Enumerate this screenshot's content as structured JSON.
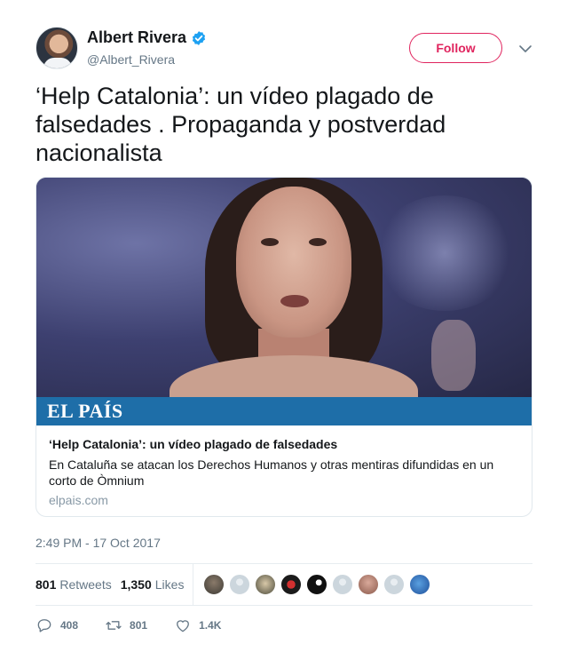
{
  "author": {
    "name": "Albert Rivera",
    "handle": "@Albert_Rivera",
    "verified": true
  },
  "follow_label": "Follow",
  "tweet_text": "‘Help Catalonia’: un vídeo plagado de falsedades . Propaganda y postverdad nacionalista",
  "card": {
    "brand": "EL PAÍS",
    "title": "‘Help Catalonia’: un vídeo plagado de falsedades",
    "description": "En Cataluña se atacan los Derechos Humanos y otras mentiras difundidas en un corto de Òmnium",
    "domain": "elpais.com"
  },
  "timestamp": "2:49 PM - 17 Oct 2017",
  "stats": {
    "retweets_count": "801",
    "retweets_label": "Retweets",
    "likes_count": "1,350",
    "likes_label": "Likes"
  },
  "actions": {
    "replies": "408",
    "retweets": "801",
    "likes": "1.4K"
  },
  "colors": {
    "follow_accent": "#e0245e",
    "verified_blue": "#1da1f2",
    "brand_bar": "#1e6ea8",
    "secondary_text": "#657786"
  },
  "icons": [
    "verified-badge-icon",
    "chevron-down-icon",
    "reply-icon",
    "retweet-icon",
    "like-icon"
  ]
}
